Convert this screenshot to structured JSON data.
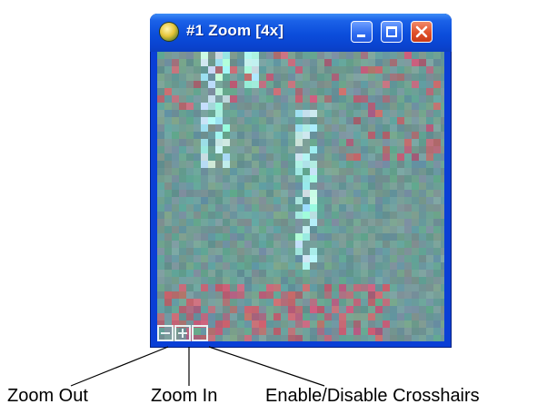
{
  "window": {
    "title": "#1 Zoom [4x]",
    "title_color": "#ffffff",
    "titlebar_color": "#0a4ddb",
    "close_color": "#e0502a"
  },
  "icons": {
    "app": "globe-icon",
    "minimize": "minimize-icon",
    "maximize": "maximize-icon",
    "close": "close-icon"
  },
  "zoom_tools": [
    {
      "name": "zoom-out",
      "icon": "minus-box-icon"
    },
    {
      "name": "zoom-in",
      "icon": "plus-box-icon"
    },
    {
      "name": "crosshairs-toggle",
      "icon": "square-box-icon"
    }
  ],
  "callouts": {
    "zoom_out": "Zoom Out",
    "zoom_in": "Zoom In",
    "crosshairs": "Enable/Disable Crosshairs"
  }
}
